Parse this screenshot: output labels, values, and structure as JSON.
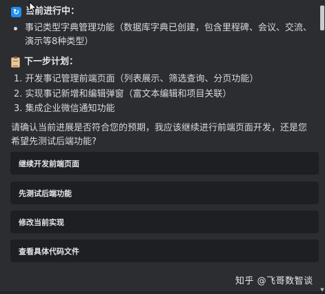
{
  "current_progress": {
    "heading": "当前进行中：",
    "items": [
      "事记类型字典管理功能（数据库字典已创建，包含里程碑、会议、交流、演示等8种类型）"
    ]
  },
  "next_plan": {
    "heading": "下一步计划：",
    "items": [
      "1. 开发事记管理前端页面（列表展示、筛选查询、分页功能）",
      "2. 实现事记新增和编辑弹窗（富文本编辑和项目关联）",
      "3. 集成企业微信通知功能"
    ]
  },
  "question": "请确认当前进展是否符合您的预期，我应该继续进行前端页面开发，还是您希望先测试后端功能?",
  "options": [
    "继续开发前端页面",
    "先测试后端功能",
    "修改当前实现",
    "查看具体代码文件"
  ],
  "watermark": "知乎 @飞哥数智谈",
  "icons": {
    "current": "refresh-icon",
    "plan": "clipboard-icon"
  },
  "colors": {
    "background": "#2b2d31",
    "button_bg": "#1e1f22",
    "accent": "#1e8ff0"
  }
}
